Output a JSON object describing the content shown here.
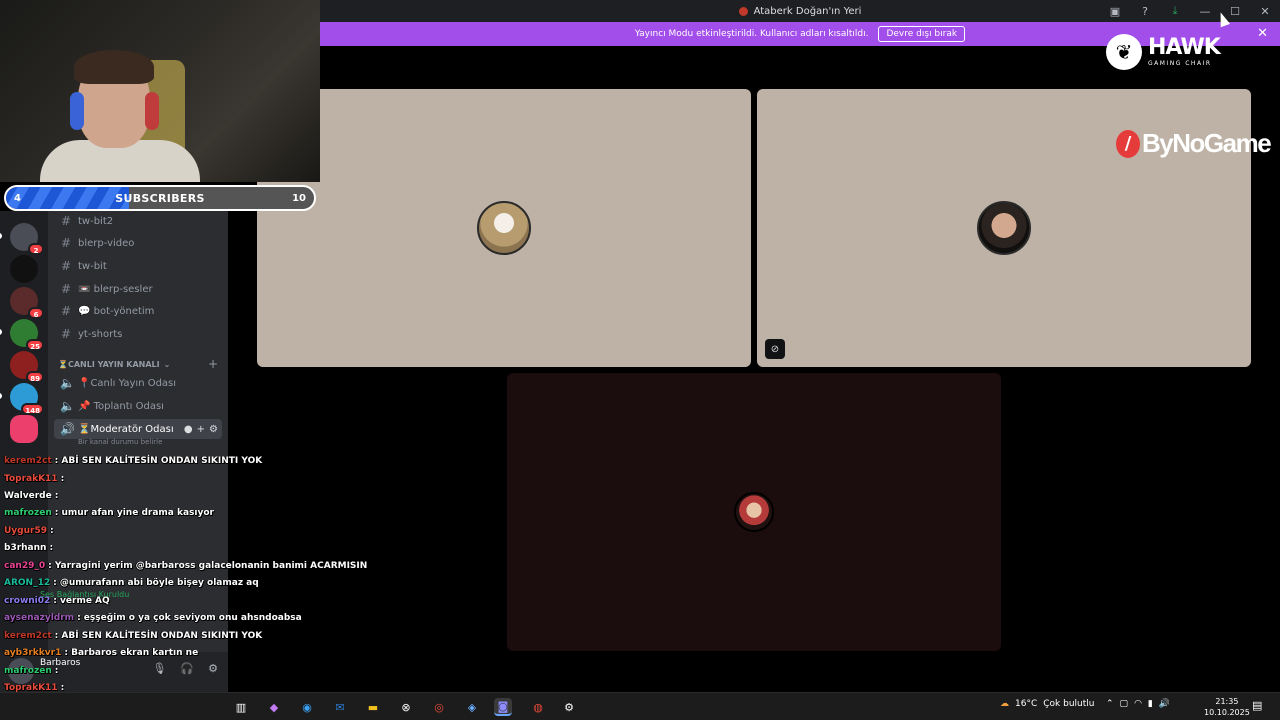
{
  "window": {
    "title": "Ataberk Doğan'ın Yeri",
    "icons": [
      "inbox-icon",
      "help-icon",
      "download-icon",
      "minimize-icon",
      "maximize-icon",
      "close-icon"
    ]
  },
  "banner": {
    "text": "Yayıncı Modu etkinleştirildi. Kullanıcı adları kısaltıldı.",
    "button": "Devre dışı bırak",
    "close": "✕"
  },
  "subscribers": {
    "label": "SUBSCRIBERS",
    "current": "4",
    "goal": "10",
    "progress": 0.4,
    "fill_color": "#1d57d6"
  },
  "servers": {
    "badges": [
      "2",
      "6",
      "25",
      "89",
      "148"
    ]
  },
  "channels": {
    "text": [
      {
        "label": "tw-bit2"
      },
      {
        "label": "blerp-video"
      },
      {
        "label": "tw-bit"
      },
      {
        "label": "📼 blerp-sesler"
      },
      {
        "label": "💬 bot-yönetim"
      },
      {
        "label": "yt-shorts"
      }
    ],
    "category": "⏳CANLI YAYIN KANALI",
    "voice": [
      {
        "label": "📍Canlı Yayın Odası"
      },
      {
        "label": "📌 Toplantı Odası"
      },
      {
        "label": "⏳Moderatör Odası"
      }
    ],
    "active_subtitle": "Bir kanal durumu belirle",
    "hidden": [
      "Metlek",
      "Yancıların Mekanı",
      "Yayın Odası"
    ]
  },
  "voice_status": "Ses Bağlantısı Kuruldu",
  "user": {
    "name": "Barbaros"
  },
  "chat": [
    {
      "user": "kerem2ct",
      "color": "#c0392b",
      "text": "ABİ SEN KALİTESİN ONDAN SIKINTI YOK"
    },
    {
      "user": "ToprakK11",
      "color": "#e74c3c",
      "text": ""
    },
    {
      "user": "Walverde",
      "color": "#ffffff",
      "text": ""
    },
    {
      "user": "mafrozen",
      "color": "#2ecc71",
      "text": "umur afan yine drama kasıyor"
    },
    {
      "user": "Uygur59",
      "color": "#e74c3c",
      "text": ""
    },
    {
      "user": "b3rhann",
      "color": "#ffffff",
      "text": ""
    },
    {
      "user": "can29_0",
      "color": "#e84393",
      "text": "Yarragini yerim @barbaross galacelonanin banimi ACARMISIN"
    },
    {
      "user": "ARON_12",
      "color": "#1abc9c",
      "text": "@umurafann abi böyle bişey olamaz aq"
    },
    {
      "user": "crowni02",
      "color": "#8e7cf0",
      "text": "verme AQ"
    },
    {
      "user": "aysenazyldrm",
      "color": "#9b59b6",
      "text": "eşşeğim o ya çok seviyom onu ahsndoabsa"
    },
    {
      "user": "kerem2ct",
      "color": "#c0392b",
      "text": "ABİ SEN KALİTESİN ONDAN SIKINTI YOK"
    },
    {
      "user": "ayb3rkkvr1",
      "color": "#e67e22",
      "text": "Barbaros ekran kartın ne"
    },
    {
      "user": "mafrozen",
      "color": "#2ecc71",
      "text": ""
    },
    {
      "user": "ToprakK11",
      "color": "#e74c3c",
      "text": ""
    },
    {
      "user": "dogu_yet9",
      "color": "#3498db",
      "text": "ataberk abi yayın nerde"
    }
  ],
  "sponsors": {
    "hawk": {
      "name": "HAWK",
      "sub": "GAMING CHAIR"
    },
    "bynogame": {
      "name": "ByNoGame"
    }
  },
  "taskbar": {
    "weather": {
      "temp": "16°C",
      "desc": "Çok bulutlu"
    },
    "time": "21:35",
    "date": "10.10.2025"
  }
}
